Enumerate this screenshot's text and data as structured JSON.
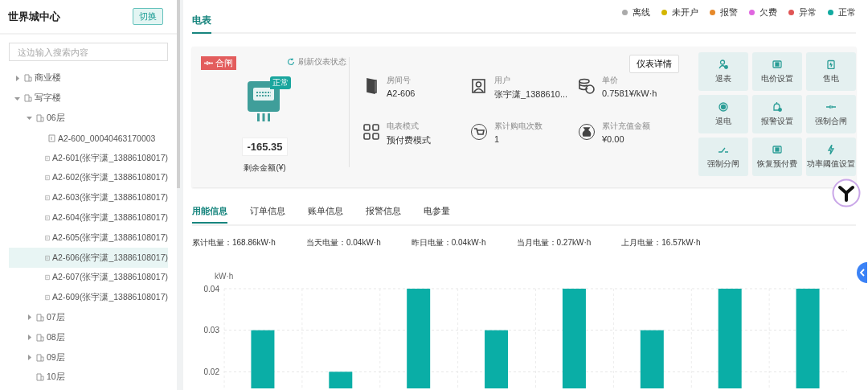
{
  "sidebar": {
    "title": "世界城中心",
    "switch_button": "切换",
    "search": {
      "placeholder": "这边输入搜索内容"
    },
    "tree": [
      {
        "label": "商业楼",
        "kind": "building",
        "expanded": false,
        "selected": false
      },
      {
        "label": "写字楼",
        "kind": "building",
        "expanded": true,
        "selected": false,
        "children": [
          {
            "label": "06层",
            "kind": "building",
            "expanded": true,
            "selected": false,
            "children": [
              {
                "label": "A2-600_00040463170003",
                "kind": "meter",
                "selected": false
              },
              {
                "label": "A2-601(张宇潇_13886108017)",
                "kind": "meter",
                "selected": false
              },
              {
                "label": "A2-602(张宇潇_13886108017)",
                "kind": "meter",
                "selected": false
              },
              {
                "label": "A2-603(张宇潇_13886108017)",
                "kind": "meter",
                "selected": false
              },
              {
                "label": "A2-604(张宇潇_13886108017)",
                "kind": "meter",
                "selected": false
              },
              {
                "label": "A2-605(张宇潇_13886108017)",
                "kind": "meter",
                "selected": false
              },
              {
                "label": "A2-606(张宇潇_13886108017)",
                "kind": "meter",
                "selected": true
              },
              {
                "label": "A2-607(张宇潇_13886108017)",
                "kind": "meter",
                "selected": false
              },
              {
                "label": "A2-609(张宇潇_13886108017)",
                "kind": "meter",
                "selected": false
              }
            ]
          },
          {
            "label": "07层",
            "kind": "building",
            "expanded": false,
            "selected": false
          },
          {
            "label": "08层",
            "kind": "building",
            "expanded": false,
            "selected": false
          },
          {
            "label": "09层",
            "kind": "building",
            "expanded": false,
            "selected": false
          },
          {
            "label": "10层",
            "kind": "building",
            "selected": false
          }
        ]
      }
    ]
  },
  "main_tab": {
    "label": "电表",
    "selected": true
  },
  "legend": [
    {
      "label": "离线",
      "color": "#aaaaaa"
    },
    {
      "label": "未开户",
      "color": "#d4b600"
    },
    {
      "label": "报警",
      "color": "#e6892a"
    },
    {
      "label": "欠费",
      "color": "#e066e0"
    },
    {
      "label": "异常",
      "color": "#e05555"
    },
    {
      "label": "正常",
      "color": "#11aaa0"
    }
  ],
  "meter": {
    "switch_state": "合闸",
    "refresh": "刷新仪表状态",
    "status": "正常",
    "balance": "-165.35",
    "balance_label": "剩余金额(¥)",
    "detail_button": "仪表详情",
    "info": [
      {
        "kind": "door",
        "label": "房间号",
        "value": "A2-606"
      },
      {
        "kind": "user",
        "label": "用户",
        "value": "张宇潇_1388610..."
      },
      {
        "kind": "coins",
        "label": "单价",
        "value": "0.7581¥/kW·h"
      },
      {
        "kind": "grid",
        "label": "电表模式",
        "value": "预付费模式"
      },
      {
        "kind": "cart",
        "label": "累计购电次数",
        "value": "1"
      },
      {
        "kind": "bag",
        "label": "累计充值金额",
        "value": "¥0.00"
      }
    ]
  },
  "actions": [
    {
      "kind": "person",
      "label": "退表"
    },
    {
      "kind": "square",
      "label": "电价设置"
    },
    {
      "kind": "clipboard",
      "label": "售电"
    },
    {
      "kind": "circle",
      "label": "退电"
    },
    {
      "kind": "bell",
      "label": "报警设置"
    },
    {
      "kind": "plug",
      "label": "强制合闸"
    },
    {
      "kind": "switch",
      "label": "强制分闸"
    },
    {
      "kind": "square",
      "label": "恢复预付费"
    },
    {
      "kind": "bolt",
      "label": "功率阈值设置"
    }
  ],
  "sub_tabs": [
    {
      "label": "用能信息",
      "selected": true
    },
    {
      "label": "订单信息",
      "selected": false
    },
    {
      "label": "账单信息",
      "selected": false
    },
    {
      "label": "报警信息",
      "selected": false
    },
    {
      "label": "电参量",
      "selected": false
    }
  ],
  "stats": [
    "累计电量：168.86kW·h",
    "当天电量：0.04kW·h",
    "昨日电量：0.04kW·h",
    "当月电量：0.27kW·h",
    "上月电量：16.57kW·h"
  ],
  "chart": {
    "chart_data": {
      "type": "bar",
      "ylabel": "kW·h",
      "series": [
        {
          "color": "#0aaea6",
          "values": [
            0.03,
            0.02,
            0.04,
            0.03,
            0.04,
            0.03,
            0.04,
            0.04
          ]
        }
      ],
      "ylim": [
        0.016,
        0.04
      ],
      "yticks": [
        0.02,
        0.03,
        0.04
      ]
    }
  }
}
